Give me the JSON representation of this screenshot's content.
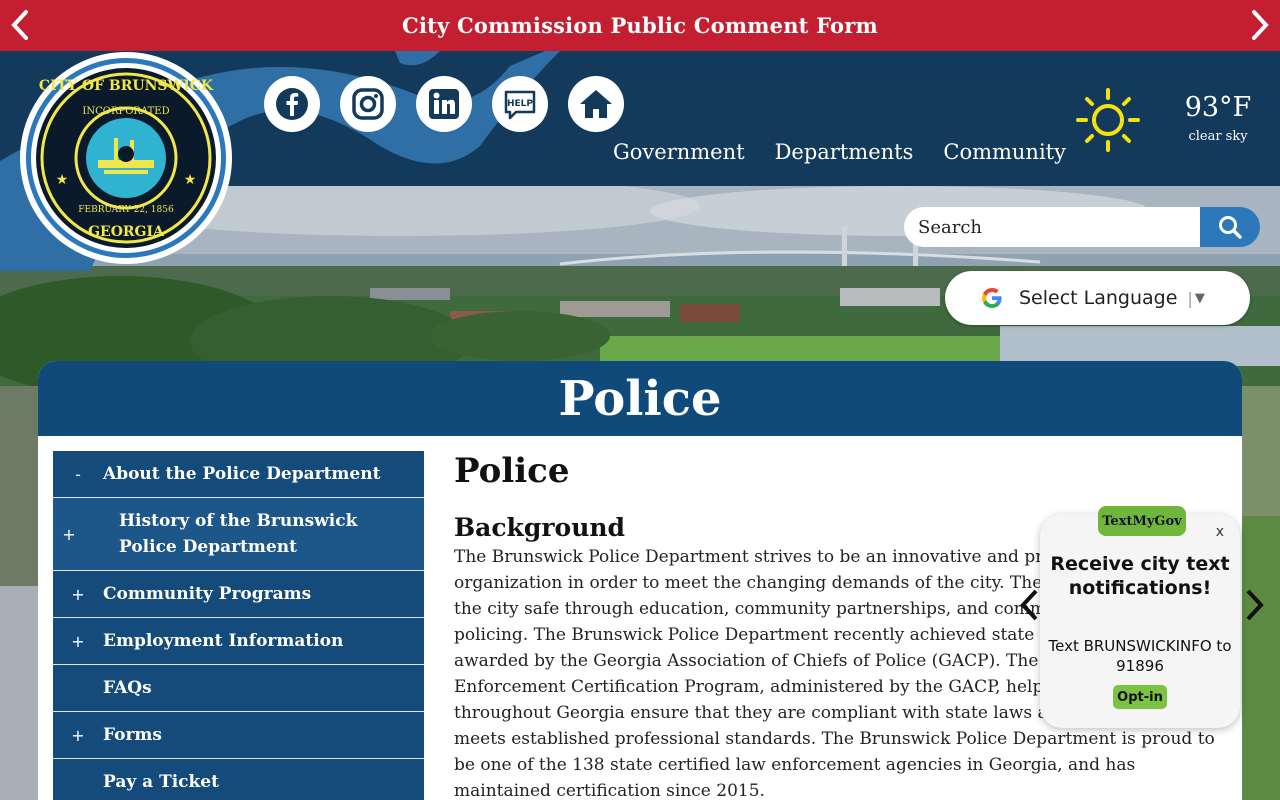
{
  "alert": {
    "title": "City Commission Public Comment Form",
    "prev_icon": "chevron-left-icon",
    "next_icon": "chevron-right-icon"
  },
  "logo": {
    "text_top": "CITY OF BRUNSWICK",
    "text_inner": "INCORPORATED",
    "text_date": "FEBRUARY 22, 1856",
    "text_bottom": "GEORGIA"
  },
  "social": [
    {
      "icon": "facebook-icon",
      "label": "Facebook"
    },
    {
      "icon": "instagram-icon",
      "label": "Instagram"
    },
    {
      "icon": "linkedin-icon",
      "label": "LinkedIn"
    },
    {
      "icon": "help-icon",
      "label": "HELP"
    },
    {
      "icon": "home-icon",
      "label": "Home"
    }
  ],
  "nav": [
    "Government",
    "Departments",
    "Community"
  ],
  "weather": {
    "icon": "sun-icon",
    "temp": "93°F",
    "desc": "clear sky"
  },
  "search": {
    "placeholder": "Search",
    "icon": "search-icon"
  },
  "language": {
    "label": "Select Language",
    "separator": "|",
    "caret": "▼",
    "icon": "google-icon"
  },
  "page": {
    "banner_title": "Police",
    "heading": "Police",
    "subheading": "Background",
    "body": "The Brunswick Police Department strives to be an innovative and progressive organization in order to meet the changing demands of the city. The department keeps the city safe through education, community partnerships, and community oriented policing. The Brunswick Police Department recently achieved state recertification as awarded by the Georgia Association of Chiefs of Police (GACP). The Georgia Law Enforcement Certification Program, administered by the GACP, helps agencies throughout Georgia ensure that they are compliant with state laws and that the agency meets established professional standards. The Brunswick Police Department is proud to be one of the 138 state certified law enforcement agencies in Georgia, and has maintained certification since 2015."
  },
  "sidebar": [
    {
      "toggle": "-",
      "label": "About the Police Department"
    },
    {
      "toggle": "+",
      "label": "History of the Brunswick Police Department"
    },
    {
      "toggle": "+",
      "label": "Community Programs"
    },
    {
      "toggle": "+",
      "label": "Employment Information"
    },
    {
      "toggle": "",
      "label": "FAQs"
    },
    {
      "toggle": "+",
      "label": "Forms"
    },
    {
      "toggle": "",
      "label": "Pay a Ticket"
    }
  ],
  "textmygov": {
    "brand": "TextMyGov",
    "close": "x",
    "headline": "Receive city text notifications!",
    "instruction": "Text BRUNSWICKINFO to 91896",
    "button": "Opt-in"
  },
  "colors": {
    "alert_red": "#c41f30",
    "header_navy": "#13395b",
    "swoosh_blue": "#2f6fa5",
    "banner_blue": "#0f4a7a",
    "sidebar_blue": "#144b7b",
    "search_blue": "#2d78ba",
    "optin_green": "#7dc242"
  }
}
